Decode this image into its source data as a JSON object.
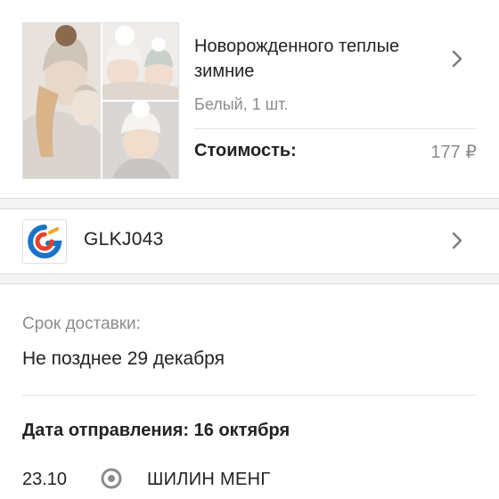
{
  "product": {
    "title": "Новорожденного теплые зимние",
    "variant": "Белый, 1 шт.",
    "cost_label": "Стоимость:",
    "cost_value": "177 ₽",
    "chevron_icon": "chevron-right-icon"
  },
  "store": {
    "name": "GLKJ043",
    "logo_icon": "store-logo-icon",
    "logo_colors": [
      "#1a73c9",
      "#e8402a",
      "#f2a51e"
    ]
  },
  "delivery": {
    "deadline_label": "Срок доставки:",
    "deadline_value": "Не позднее 29 декабря",
    "ship_date": "Дата отправления: 16 октября"
  },
  "tracking": {
    "events": [
      {
        "date": "23.10",
        "text": "ШИЛИН МЕНГ"
      }
    ]
  }
}
